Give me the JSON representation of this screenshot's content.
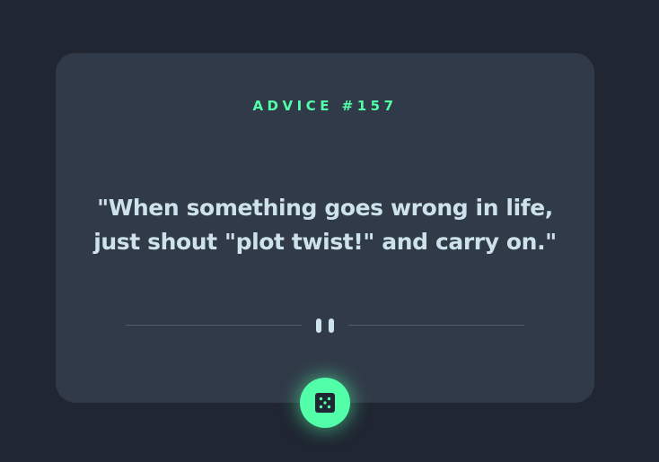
{
  "advice": {
    "label": "ADVICE #157",
    "quote": "\"When something goes wrong in life, just shout \"plot twist!\" and carry on.\""
  },
  "divider": {
    "icon": "pause-icon"
  },
  "dice_button": {
    "icon": "dice-icon"
  },
  "colors": {
    "background": "#202632",
    "card": "#313a48",
    "accent": "#52ffa8",
    "text": "#cee3e9",
    "divider_line": "#4f5d74"
  }
}
